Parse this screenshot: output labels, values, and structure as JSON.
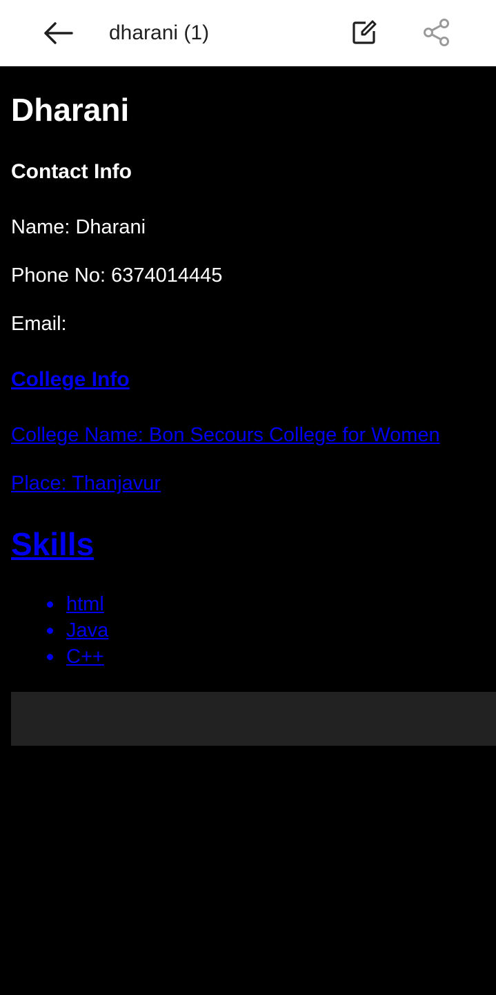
{
  "appbar": {
    "title": "dharani (1)",
    "icons": {
      "back": "arrow-left-icon",
      "edit": "edit-icon",
      "share": "share-icon"
    }
  },
  "page": {
    "heading": "Dharani",
    "contact_heading": "Contact Info",
    "name_line": "Name: Dharani",
    "phone_line": "Phone No: 6374014445",
    "email_line": "Email:",
    "college_heading": "College Info",
    "college_name_line": "College Name: Bon Secours College for Women",
    "place_line": "Place: Thanjavur",
    "skills_heading": "Skills",
    "skills": [
      "html",
      "Java",
      "C++"
    ]
  },
  "colors": {
    "appbar_bg": "#ffffff",
    "content_bg": "#000000",
    "text": "#ffffff",
    "link": "#0000ee",
    "footer_box": "#222222"
  }
}
